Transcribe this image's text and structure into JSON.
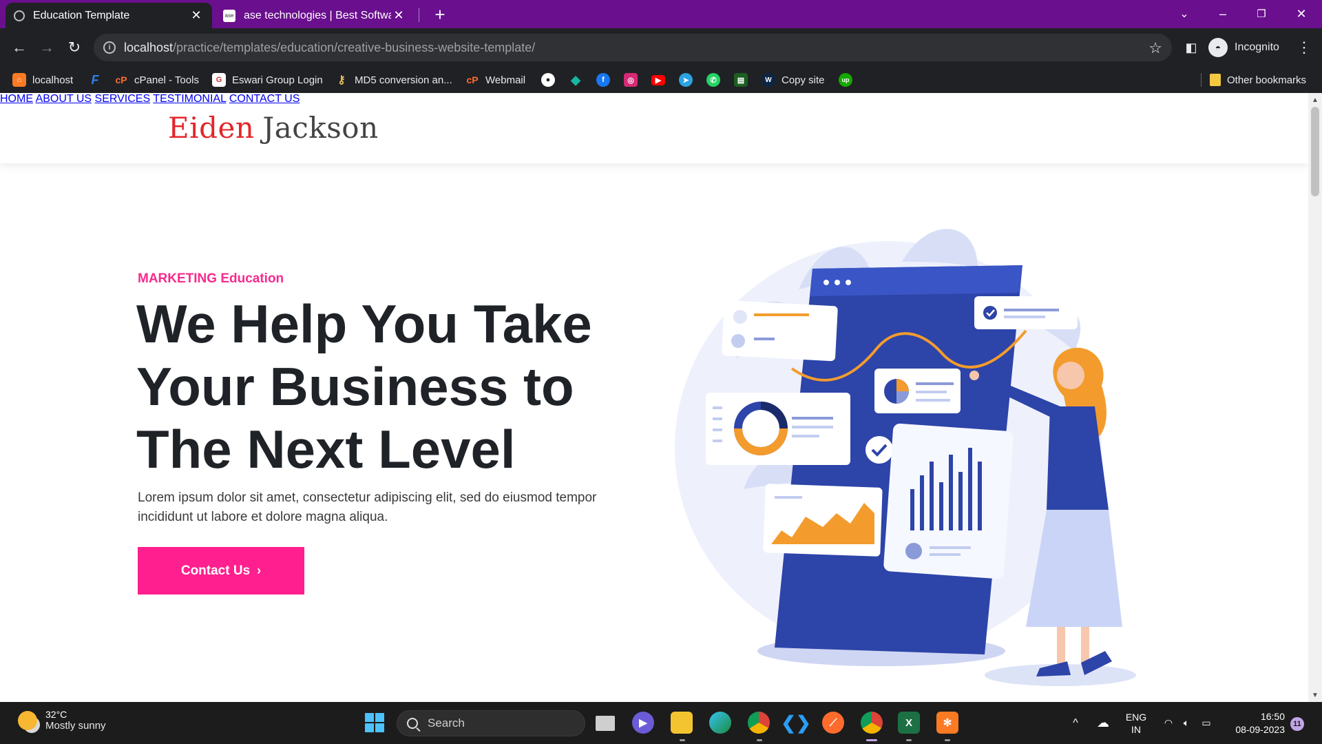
{
  "browser": {
    "tabs": [
      {
        "title": "Education Template",
        "active": true,
        "icon": "globe-icon"
      },
      {
        "title": "ase technologies | Best Software",
        "active": false,
        "icon": "ase-favicon",
        "favicon_text": "ase"
      }
    ],
    "new_tab_glyph": "+",
    "url_host": "localhost",
    "url_path": "/practice/templates/education/creative-business-website-template/",
    "profile_label": "Incognito",
    "accent_color": "#6a0f8e"
  },
  "bookmarks": [
    {
      "label": "localhost",
      "icon": "xampp-icon"
    },
    {
      "label": "",
      "icon": "f-icon"
    },
    {
      "label": "cPanel - Tools",
      "icon": "cpanel-icon"
    },
    {
      "label": "Eswari Group Login",
      "icon": "eswari-icon"
    },
    {
      "label": "MD5 conversion an...",
      "icon": "key-icon"
    },
    {
      "label": "Webmail",
      "icon": "cpanel-icon"
    },
    {
      "label": "",
      "icon": "github-icon"
    },
    {
      "label": "",
      "icon": "diamond-icon"
    },
    {
      "label": "",
      "icon": "facebook-icon"
    },
    {
      "label": "",
      "icon": "instagram-icon"
    },
    {
      "label": "",
      "icon": "youtube-icon"
    },
    {
      "label": "",
      "icon": "telegram-icon"
    },
    {
      "label": "",
      "icon": "whatsapp-icon"
    },
    {
      "label": "",
      "icon": "book-icon"
    },
    {
      "label": "Copy site",
      "icon": "w-icon"
    },
    {
      "label": "",
      "icon": "upwork-icon"
    }
  ],
  "other_bookmarks": "Other bookmarks",
  "site": {
    "logo_first": "Eiden",
    "logo_last": "Jackson",
    "nav": [
      "HOME",
      "ABOUT US",
      "SERVICES",
      "TESTIMONIAL",
      "CONTACT US"
    ],
    "eyebrow": "MARKETING Education",
    "headline": "We Help You Take Your Business to The Next Level",
    "lead": "Lorem ipsum dolor sit amet, consectetur adipiscing elit, sed do eiusmod tempor incididunt ut labore et dolore magna aliqua.",
    "cta_label": "Contact Us",
    "cta_glyph": "›",
    "brand_red": "#e3262b",
    "brand_pink": "#ff1f8e"
  },
  "taskbar": {
    "temperature": "32°C",
    "weather": "Mostly sunny",
    "search_placeholder": "Search",
    "language": "ENG",
    "region": "IN",
    "time": "16:50",
    "date": "08-09-2023",
    "notifications": "11"
  }
}
